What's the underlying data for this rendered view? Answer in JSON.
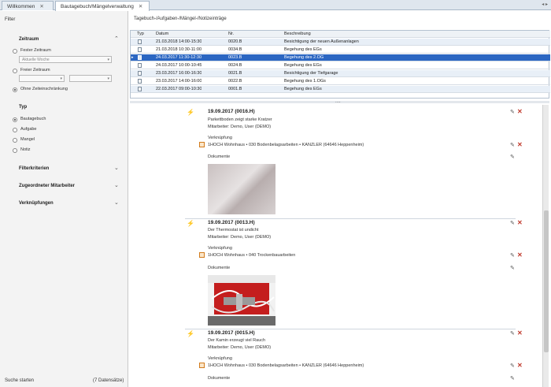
{
  "tabs": {
    "home": "Willkommen",
    "active": "Bautagebuch/Mängelverwaltung",
    "nav": "◂ ▸"
  },
  "sidebar": {
    "title": "Filter",
    "zeitraum": {
      "heading": "Zeitraum",
      "fester": "Fester Zeitraum",
      "fester_value": "Aktuelle Woche",
      "freier": "Freier Zeitraum",
      "ohne": "Ohne Zeiteinschränkung"
    },
    "typ": {
      "heading": "Typ",
      "options": [
        "Bautagebuch",
        "Aufgabe",
        "Mangel",
        "Notiz"
      ]
    },
    "sections": [
      "Filterkriterien",
      "Zugeordneter Mitarbeiter",
      "Verknüpfungen"
    ],
    "footer_left": "Suche starten",
    "footer_right": "(7 Datensätze)"
  },
  "main": {
    "breadcrumb": "Tagebuch-/Aufgaben-/Mängel-/Notizeinträge",
    "grid_columns": [
      "Typ",
      "Datum",
      "Nr.",
      "Beschreibung"
    ],
    "grid_rows": [
      {
        "datum": "21.03.2018 14:00-15:30",
        "nr": "0020.B",
        "beschreibung": "Besichtigung der neuen Außenanlagen"
      },
      {
        "datum": "21.03.2018 10:30-11:00",
        "nr": "0034.B",
        "beschreibung": "Begehung des EGs"
      },
      {
        "datum": "24.03.2017 11:30-12:30",
        "nr": "0023.B",
        "beschreibung": "Begehung des 2.OG"
      },
      {
        "datum": "24.03.2017 10:00-10:45",
        "nr": "0024.B",
        "beschreibung": "Begehung des EGs"
      },
      {
        "datum": "23.03.2017 16:00-16:30",
        "nr": "0021.B",
        "beschreibung": "Besichtigung der Tiefgarage"
      },
      {
        "datum": "23.03.2017 14:00-16:00",
        "nr": "0022.B",
        "beschreibung": "Begehung des 1.OGs"
      },
      {
        "datum": "22.03.2017 09:00-10:30",
        "nr": "0001.B",
        "beschreibung": "Begehung des EGs"
      }
    ],
    "grip": "....",
    "entries": [
      {
        "title": "19.09.2017 (0016.H)",
        "text": "Parkettboden zeigt starke Kratzer",
        "mitarbeiter": "Mitarbeiter: Demo, User (DEMO)",
        "verknuepfung_label": "Verknüpfung",
        "verknuepfung": "1HOCH Wohnhaus • 030 Bodenbelagsarbeiten • KANZLER (64646 Heppenheim)",
        "dokumente_label": "Dokumente"
      },
      {
        "title": "19.09.2017 (0013.H)",
        "text": "Der Thermostat ist undicht",
        "mitarbeiter": "Mitarbeiter: Demo, User (DEMO)",
        "verknuepfung_label": "Verknüpfung",
        "verknuepfung": "1HOCH Wohnhaus • 040 Trockenbauarbeiten",
        "dokumente_label": "Dokumente"
      },
      {
        "title": "19.09.2017 (0015.H)",
        "text": "Der Kamin erzeugt viel Rauch",
        "mitarbeiter": "Mitarbeiter: Demo, User (DEMO)",
        "verknuepfung_label": "Verknüpfung",
        "verknuepfung": "1HOCH Wohnhaus • 030 Bodenbelagsarbeiten • KANZLER (64646 Heppenheim)",
        "dokumente_label": "Dokumente"
      }
    ]
  },
  "colors": {
    "selected_row": "#2b66c2",
    "alt_row": "#e8eff7",
    "accent_bolt": "#e0a21a",
    "delete": "#c0392b"
  },
  "icons": {
    "bolt": "lightning-icon",
    "pen": "edit-pencil-icon",
    "del": "delete-x-icon",
    "link": "link-icon",
    "doc": "document-icon"
  }
}
